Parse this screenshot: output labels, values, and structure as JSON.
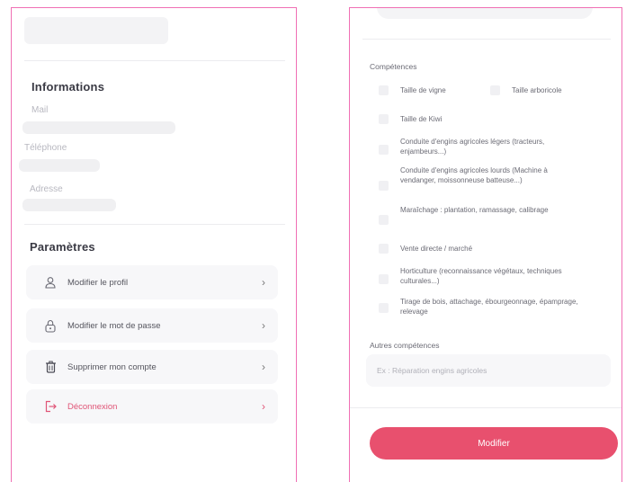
{
  "left": {
    "informations": {
      "title": "Informations",
      "mail_label": "Mail",
      "phone_label": "Téléphone",
      "address_label": "Adresse"
    },
    "parametres": {
      "title": "Paramètres",
      "items": [
        {
          "label": "Modifier le profil",
          "icon": "user-icon"
        },
        {
          "label": "Modifier le mot de passe",
          "icon": "lock-icon"
        },
        {
          "label": "Supprimer mon compte",
          "icon": "trash-icon"
        },
        {
          "label": "Déconnexion",
          "icon": "logout-icon"
        }
      ],
      "chevron": "›"
    }
  },
  "right": {
    "competences_label": "Compétences",
    "options": [
      "Taille de vigne",
      "Taille arboricole",
      "Taille de Kiwi",
      "Conduite d'engins agricoles légers (tracteurs, enjambeurs...)",
      "Conduite d'engins agricoles lourds (Machine à vendanger, moissonneuse batteuse...)",
      "Maraîchage : plantation, ramassage, calibrage",
      "Vente directe / marché",
      "Horticulture (reconnaissance végétaux, techniques culturales...)",
      "Tirage de bois, attachage, ébourgeonnage, épamprage, relevage"
    ],
    "other_label": "Autres compétences",
    "other_placeholder": "Ex : Réparation engins agricoles",
    "submit_label": "Modifier"
  },
  "colors": {
    "frame": "#f06fb4",
    "accent": "#e8506e",
    "danger": "#e05577"
  }
}
